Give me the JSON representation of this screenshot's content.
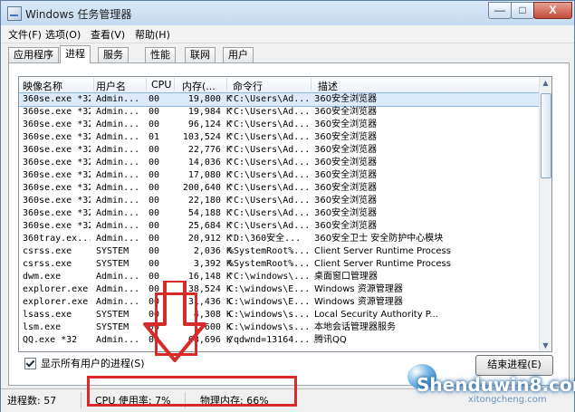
{
  "window": {
    "title": "Windows 任务管理器",
    "buttons": {
      "minimize": "—",
      "maximize": "□",
      "close": "X"
    }
  },
  "menu": [
    "文件(F)",
    "选项(O)",
    "查看(V)",
    "帮助(H)"
  ],
  "tabs": [
    {
      "label": "应用程序",
      "active": false
    },
    {
      "label": "进程",
      "active": true
    },
    {
      "label": "服务",
      "active": false
    },
    {
      "label": "性能",
      "active": false
    },
    {
      "label": "联网",
      "active": false
    },
    {
      "label": "用户",
      "active": false
    }
  ],
  "columns": {
    "name": "映像名称",
    "user": "用户名",
    "cpu": "CPU",
    "mem": "内存(...",
    "cmd": "命令行",
    "desc": "描述"
  },
  "rows": [
    {
      "name": "360se.exe *32",
      "user": "Admin...",
      "cpu": "00",
      "mem": "19,800 K",
      "cmd": "\"C:\\Users\\Ad...",
      "desc": "360安全浏览器",
      "selected": true
    },
    {
      "name": "360se.exe *32",
      "user": "Admin...",
      "cpu": "00",
      "mem": "19,984 K",
      "cmd": "\"C:\\Users\\Ad...",
      "desc": "360安全浏览器"
    },
    {
      "name": "360se.exe *32",
      "user": "Admin...",
      "cpu": "00",
      "mem": "96,124 K",
      "cmd": "\"C:\\Users\\Ad...",
      "desc": "360安全浏览器"
    },
    {
      "name": "360se.exe *32",
      "user": "Admin...",
      "cpu": "01",
      "mem": "103,524 K",
      "cmd": "\"C:\\Users\\Ad...",
      "desc": "360安全浏览器"
    },
    {
      "name": "360se.exe *32",
      "user": "Admin...",
      "cpu": "00",
      "mem": "22,776 K",
      "cmd": "\"C:\\Users\\Ad...",
      "desc": "360安全浏览器"
    },
    {
      "name": "360se.exe *32",
      "user": "Admin...",
      "cpu": "00",
      "mem": "14,036 K",
      "cmd": "\"C:\\Users\\Ad...",
      "desc": "360安全浏览器"
    },
    {
      "name": "360se.exe *32",
      "user": "Admin...",
      "cpu": "00",
      "mem": "17,080 K",
      "cmd": "\"C:\\Users\\Ad...",
      "desc": "360安全浏览器"
    },
    {
      "name": "360se.exe *32",
      "user": "Admin...",
      "cpu": "00",
      "mem": "200,640 K",
      "cmd": "\"C:\\Users\\Ad...",
      "desc": "360安全浏览器"
    },
    {
      "name": "360se.exe *32",
      "user": "Admin...",
      "cpu": "00",
      "mem": "22,180 K",
      "cmd": "\"C:\\Users\\Ad...",
      "desc": "360安全浏览器"
    },
    {
      "name": "360se.exe *32",
      "user": "Admin...",
      "cpu": "00",
      "mem": "54,188 K",
      "cmd": "\"C:\\Users\\Ad...",
      "desc": "360安全浏览器"
    },
    {
      "name": "360se.exe *32",
      "user": "Admin...",
      "cpu": "00",
      "mem": "25,684 K",
      "cmd": "\"C:\\Users\\Ad...",
      "desc": "360安全浏览器"
    },
    {
      "name": "360tray.ex...",
      "user": "Admin...",
      "cpu": "00",
      "mem": "20,912 K",
      "cmd": "\"D:\\360安全...",
      "desc": "360安全卫士 安全防护中心模块"
    },
    {
      "name": "csrss.exe",
      "user": "SYSTEM",
      "cpu": "00",
      "mem": "2,036 K",
      "cmd": "%SystemRoot%...",
      "desc": "Client Server Runtime Process"
    },
    {
      "name": "csrss.exe",
      "user": "SYSTEM",
      "cpu": "00",
      "mem": "3,392 K",
      "cmd": "%SystemRoot%...",
      "desc": "Client Server Runtime Process"
    },
    {
      "name": "dwm.exe",
      "user": "Admin...",
      "cpu": "00",
      "mem": "16,148 K",
      "cmd": "\"C:\\windows\\...",
      "desc": "桌面窗口管理器"
    },
    {
      "name": "explorer.exe",
      "user": "Admin...",
      "cpu": "00",
      "mem": "38,524 K",
      "cmd": "C:\\windows\\E...",
      "desc": "Windows 资源管理器"
    },
    {
      "name": "explorer.exe",
      "user": "Admin...",
      "cpu": "00",
      "mem": "31,436 K",
      "cmd": "C:\\windows\\E...",
      "desc": "Windows 资源管理器"
    },
    {
      "name": "lsass.exe",
      "user": "SYSTEM",
      "cpu": "00",
      "mem": "4,308 K",
      "cmd": "C:\\windows\\s...",
      "desc": "Local Security Authority P..."
    },
    {
      "name": "lsm.exe",
      "user": "SYSTEM",
      "cpu": "00",
      "mem": "1,600 K",
      "cmd": "C:\\windows\\s...",
      "desc": "本地会话管理器服务"
    },
    {
      "name": "QQ.exe *32",
      "user": "Admin...",
      "cpu": "00",
      "mem": "68,696 K",
      "cmd": "/qdwnd=13164...",
      "desc": "腾讯QQ"
    }
  ],
  "show_all_label": "显示所有用户的进程(S)",
  "end_process": "结束进程(E)",
  "status": {
    "processes": "进程数: 57",
    "cpu": "CPU 使用率: 7%",
    "memory": "物理内存: 66%"
  },
  "watermark": {
    "text": "Shenduwin8.com",
    "small": "xitongcheng.com"
  }
}
